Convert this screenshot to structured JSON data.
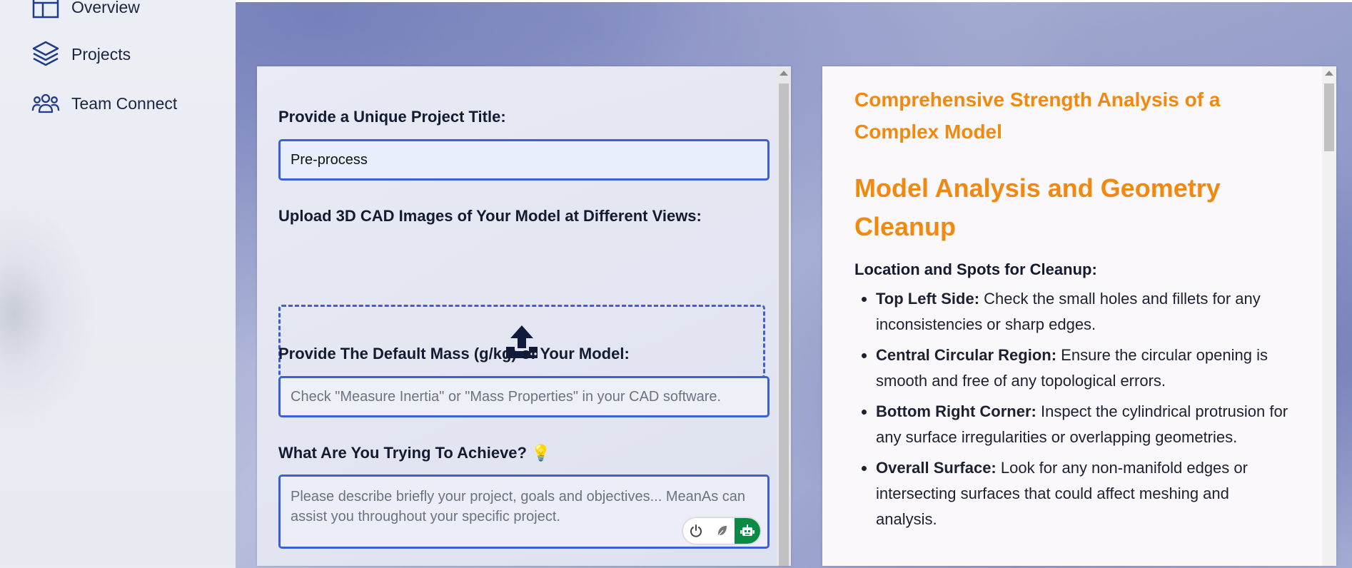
{
  "sidebar": {
    "items": [
      {
        "label": "Overview",
        "icon": "overview-icon"
      },
      {
        "label": "Projects",
        "icon": "layers-icon"
      },
      {
        "label": "Team Connect",
        "icon": "team-icon"
      }
    ]
  },
  "form": {
    "title_label": "Provide a Unique Project Title:",
    "title_value": "Pre-process",
    "upload_label": "Upload 3D CAD Images of Your Model at Different Views:",
    "upload_icon": "upload-icon",
    "mass_label": "Provide The Default Mass (g/kg) of Your Model:",
    "mass_placeholder": "Check \"Measure Inertia\" or \"Mass Properties\" in your CAD software.",
    "goal_label": "What Are You Trying To Achieve? 💡",
    "goal_placeholder": "Please describe briefly your project, goals and objectives... MeanAs can assist you throughout your specific project.",
    "tools": [
      "power-icon",
      "feather-icon",
      "robot-icon"
    ]
  },
  "analysis": {
    "subtitle": "Comprehensive Strength Analysis of a Complex Model",
    "title": "Model Analysis and Geometry Cleanup",
    "section_heading": "Location and Spots for Cleanup:",
    "items": [
      {
        "term": "Top Left Side:",
        "text": " Check the small holes and fillets for any inconsistencies or sharp edges."
      },
      {
        "term": "Central Circular Region:",
        "text": " Ensure the circular opening is smooth and free of any topological errors."
      },
      {
        "term": "Bottom Right Corner:",
        "text": " Inspect the cylindrical protrusion for any surface irregularities or overlapping geometries."
      },
      {
        "term": "Overall Surface:",
        "text": " Look for any non-manifold edges or intersecting surfaces that could affect meshing and analysis."
      }
    ]
  },
  "colors": {
    "accent": "#3d5fd6",
    "heading_orange": "#f0890d",
    "robot_green": "#0b8a43"
  }
}
